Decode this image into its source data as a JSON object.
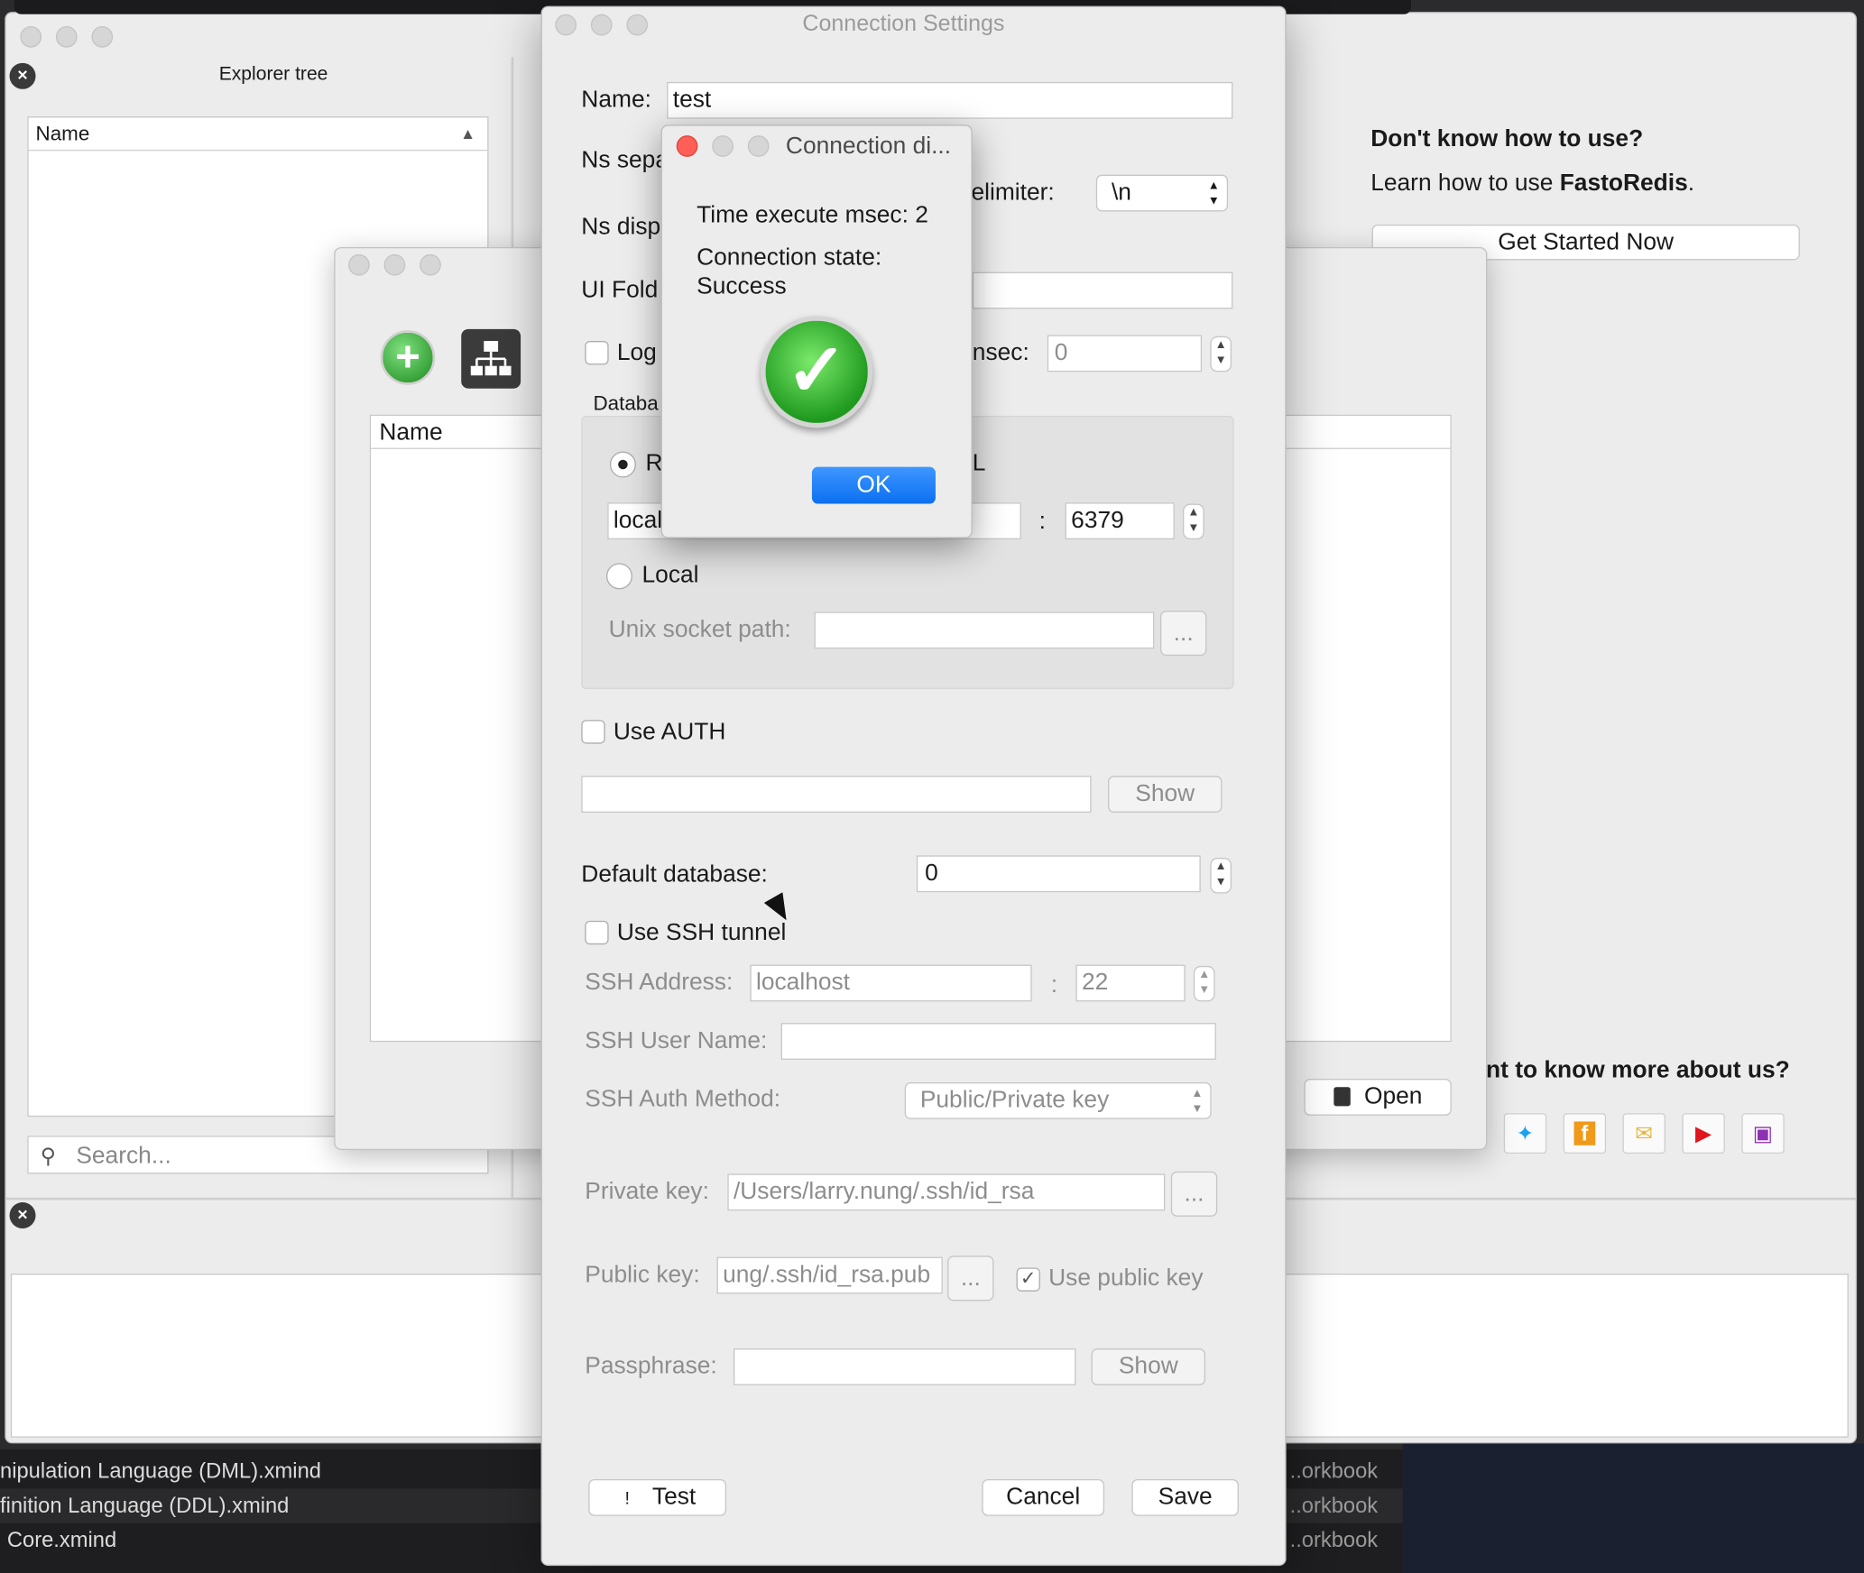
{
  "finder": {
    "rows": [
      {
        "name": "nipulation Language (DML).xmind",
        "kind": "..orkbook"
      },
      {
        "name": "finition Language (DDL).xmind",
        "kind": "..orkbook"
      },
      {
        "name": "Core.xmind",
        "kind": "..orkbook"
      }
    ]
  },
  "explorer": {
    "title": "Explorer tree",
    "column": "Name",
    "sort_arrow": "▲",
    "search_placeholder": "Search..."
  },
  "welcome": {
    "question": "Don't know how to use?",
    "learn_prefix": "Learn how to use ",
    "product": "FastoRedis",
    "learn_suffix": ".",
    "get_started": "Get Started Now",
    "know_more": "nt to know more about us?",
    "social_icons": [
      "twitter-icon",
      "facebook-icon",
      "mail-icon",
      "youtube-icon",
      "instagram-icon"
    ],
    "social_colors": {
      "twitter": "#1da1f2",
      "facebook": "#f09a1a",
      "mail": "#e8b63a",
      "youtube": "#e0161c",
      "instagram": "#8e2fb5"
    }
  },
  "connections": {
    "column": "Name",
    "open_button": "Open"
  },
  "settings": {
    "title": "Connection Settings",
    "name_label": "Name:",
    "name_value": "test",
    "ns_separator_label": "Ns sepa",
    "ns_display_label": "Ns disp",
    "delimiter_label": "elimiter:",
    "delimiter_value": "\\n",
    "ui_folder_label": "UI Fold",
    "logging_label": "Log",
    "logging_msec_label": "nsec:",
    "logging_msec_value": "0",
    "database_group_label": "Databa",
    "remote_label": "R",
    "ssl_label": "L",
    "host_value": "local",
    "port_separator": ":",
    "port_value": "6379",
    "local_label": "Local",
    "unix_socket_label": "Unix socket path:",
    "browse_label": "...",
    "use_auth_label": "Use AUTH",
    "show_label": "Show",
    "default_db_label": "Default database:",
    "default_db_value": "0",
    "use_ssh_label": "Use SSH tunnel",
    "ssh_address_label": "SSH Address:",
    "ssh_address_value": "localhost",
    "ssh_port_value": "22",
    "ssh_user_label": "SSH User Name:",
    "ssh_auth_label": "SSH Auth Method:",
    "ssh_auth_value": "Public/Private key",
    "private_key_label": "Private key:",
    "private_key_value": "/Users/larry.nung/.ssh/id_rsa",
    "public_key_label": "Public key:",
    "public_key_value": "ung/.ssh/id_rsa.pub",
    "use_public_key_label": "Use public key",
    "passphrase_label": "Passphrase:",
    "test_button": "Test",
    "test_icon": "!",
    "cancel_button": "Cancel",
    "save_button": "Save"
  },
  "popup": {
    "title": "Connection di...",
    "time_line": "Time execute msec: 2",
    "state_label": "Connection state:",
    "state_value": "Success",
    "ok_button": "OK"
  }
}
